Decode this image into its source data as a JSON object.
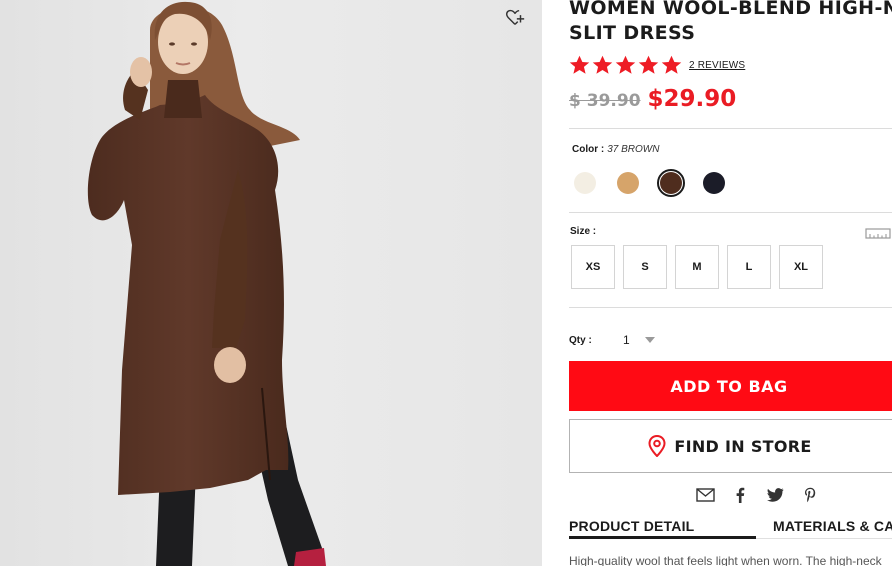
{
  "product": {
    "title_line1": "WOMEN WOOL-BLEND HIGH-NECK",
    "title_line2": "SLIT DRESS",
    "rating_stars": 5,
    "reviews_label": "2 REVIEWS",
    "old_price": "$ 39.90",
    "new_price": "$29.90"
  },
  "color": {
    "label": "Color :",
    "selected_value": "37 BROWN",
    "swatches": [
      {
        "name": "off-white",
        "hex": "#f3eee3"
      },
      {
        "name": "beige",
        "hex": "#d6a46a"
      },
      {
        "name": "brown",
        "hex": "#4f2d1e",
        "selected": true
      },
      {
        "name": "navy",
        "hex": "#1b1c28"
      }
    ]
  },
  "size": {
    "label": "Size :",
    "options": [
      "XS",
      "S",
      "M",
      "L",
      "XL"
    ]
  },
  "quantity": {
    "label": "Qty :",
    "value": "1"
  },
  "actions": {
    "add_to_bag": "ADD TO BAG",
    "find_in_store": "FIND IN STORE"
  },
  "share_icons": [
    "email-icon",
    "facebook-icon",
    "twitter-icon",
    "pinterest-icon"
  ],
  "tabs": [
    {
      "label": "PRODUCT DETAIL",
      "active": true
    },
    {
      "label": "MATERIALS & CARE",
      "active": false
    }
  ],
  "description": "High-quality wool that feels light when worn. The high-neck",
  "colors": {
    "accent_red": "#ff0a14",
    "price_red": "#ea1c24",
    "star_red": "#ee1c25",
    "text": "#1b1b1b",
    "dress_brown": "#5a3526"
  }
}
